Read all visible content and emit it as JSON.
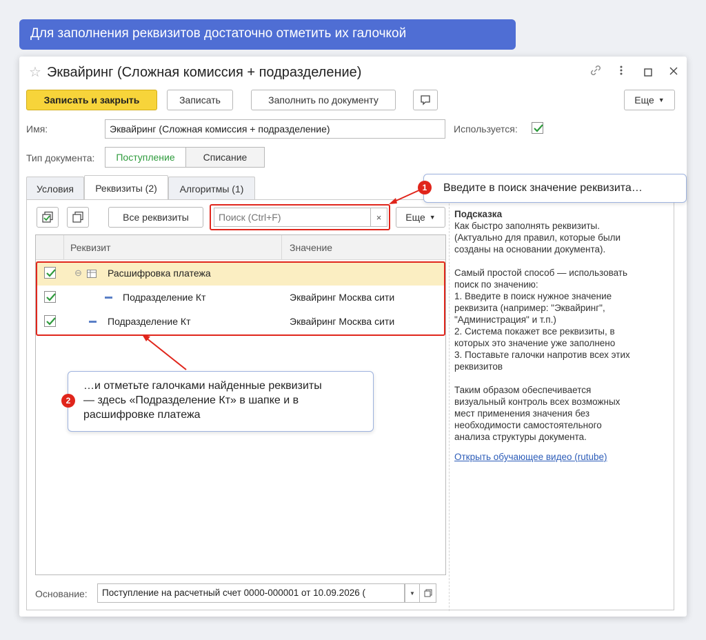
{
  "banner": "Для заполнения реквизитов достаточно отметить их галочкой",
  "window": {
    "title": "Эквайринг (Сложная комиссия + подразделение)",
    "icons": [
      "star-icon",
      "link-icon",
      "more-vert-icon",
      "maximize-icon",
      "close-icon"
    ]
  },
  "toolbar": {
    "save_close": "Записать и закрыть",
    "save": "Записать",
    "fill_by_doc": "Заполнить по документу",
    "more": "Еще"
  },
  "form": {
    "name_label": "Имя:",
    "name_value": "Эквайринг (Сложная комиссия + подразделение)",
    "used_label": "Используется:",
    "used_checked": true,
    "doc_type_label": "Тип документа:",
    "doc_type_options": [
      "Поступление",
      "Списание"
    ],
    "doc_type_selected": "Поступление"
  },
  "tabs": [
    "Условия",
    "Реквизиты (2)",
    "Алгоритмы (1)"
  ],
  "active_tab": "Реквизиты (2)",
  "requisites": {
    "all_button": "Все реквизиты",
    "search_placeholder": "Поиск (Ctrl+F)",
    "clear_glyph": "×",
    "more": "Еще",
    "columns": [
      "Реквизит",
      "Значение"
    ],
    "rows": [
      {
        "checked": true,
        "name": "Расшифровка платежа",
        "value": "",
        "level": 0,
        "group": true
      },
      {
        "checked": true,
        "name": "Подразделение Кт",
        "value": "Эквайринг Москва сити",
        "level": 1,
        "group": false
      },
      {
        "checked": true,
        "name": "Подразделение Кт",
        "value": "Эквайринг Москва сити",
        "level": 0,
        "group": false
      }
    ]
  },
  "hint": {
    "title": "Подсказка",
    "lines": [
      "Как быстро заполнять реквизиты.",
      "(Актуально для правил, которые были",
      "созданы на основании документа).",
      "",
      "Самый простой способ — использовать",
      "поиск по значению:",
      "1. Введите в поиск нужное значение",
      "реквизита (например: \"Эквайринг\",",
      "\"Администрация\" и т.п.)",
      "2. Система покажет все реквизиты, в",
      "которых это значение уже заполнено",
      "3. Поставьте галочки напротив всех этих",
      "реквизитов",
      "",
      "Таким образом обеспечивается",
      "визуальный контроль всех возможных",
      "мест применения значения без",
      "необходимости самостоятельного",
      "анализа структуры документа."
    ],
    "link": "Открыть обучающее видео (rutube)"
  },
  "basis": {
    "label": "Основание:",
    "value": "Поступление на расчетный счет 0000-000001 от 10.09.2026 ("
  },
  "callouts": {
    "c1_num": "1",
    "c1_text": "Введите в поиск значение реквизита…",
    "c2_num": "2",
    "c2_line1": "…и отметьте галочками найденные реквизиты",
    "c2_line2": "— здесь «Подразделение Кт» в шапке и в",
    "c2_line3": "расшифровке платежа"
  },
  "colors": {
    "accent_banner": "#4f6ed4",
    "primary_button": "#f7d43a",
    "highlight_red": "#e0251b",
    "checkbox_green": "#2e9b3c",
    "selected_row": "#fbeec2"
  }
}
